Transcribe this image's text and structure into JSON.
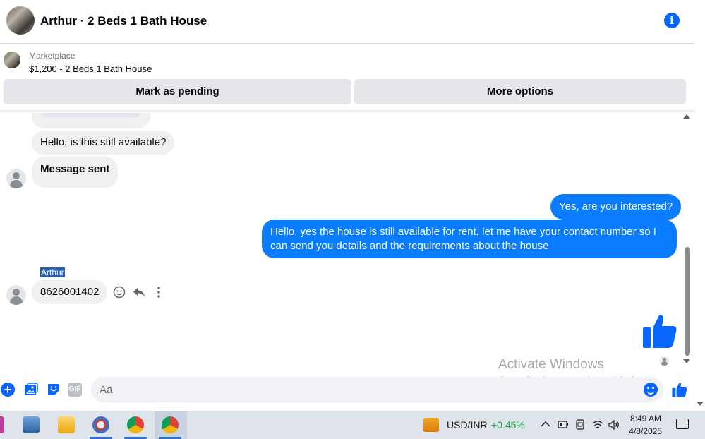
{
  "header": {
    "title": "Arthur · 2 Beds 1 Bath House",
    "info_icon": "i"
  },
  "marketplace": {
    "label": "Marketplace",
    "listing": "$1,200 - 2 Beds 1 Bath House",
    "buttons": {
      "pending": "Mark as pending",
      "more": "More options"
    }
  },
  "messages": [
    {
      "direction": "in",
      "text": "Hello, is this still available?"
    },
    {
      "direction": "in",
      "text": "Message sent"
    },
    {
      "direction": "out",
      "text": "Yes, are you interested?"
    },
    {
      "direction": "out",
      "text": "Hello, yes the house is still available for rent, let me have your contact number so I can send you details and the requirements about the house"
    },
    {
      "direction": "in",
      "sender": "Arthur",
      "text": "8626001402"
    }
  ],
  "composer": {
    "placeholder": "Aa",
    "gif_label": "GIF",
    "plus_label": "+"
  },
  "watermark": {
    "title": "Activate Windows",
    "subtitle": "Go to Settings to activate Windows."
  },
  "taskbar": {
    "fx_pair": "USD/INR",
    "fx_change": "+0.45%",
    "time": "8:49 AM",
    "date": "4/8/2025",
    "apps": [
      "app-partial",
      "control-panel",
      "file-explorer",
      "app-satellite",
      "chrome",
      "chrome-profile"
    ]
  },
  "colors": {
    "accent": "#0866ff",
    "outgoing_bubble": "#0a7cff",
    "incoming_bubble": "#f0f0f0",
    "selection": "#2a5db8",
    "fx_positive": "#18a84a"
  }
}
